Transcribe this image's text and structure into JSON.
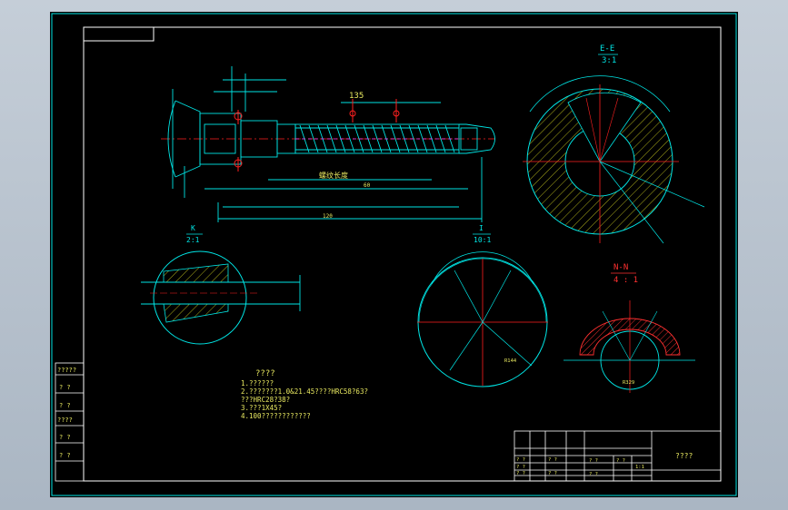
{
  "colors": {
    "background": "#000000",
    "frame": "#00e5e5",
    "outline": "#00e5e5",
    "section_line": "#ff2020",
    "hatch": "#d8d820",
    "thread": "#ff40ff",
    "text": "#e8e860"
  },
  "views": {
    "ee": {
      "label": "E-E",
      "scale": "3:1"
    },
    "k": {
      "label": "K",
      "scale": "2:1"
    },
    "i": {
      "label": "I",
      "scale": "10:1"
    },
    "nn": {
      "label": "N-N",
      "scale": "4 : 1"
    }
  },
  "dims": {
    "d135": "135",
    "d120": "120",
    "thread_callout": "螺纹长度",
    "d_total": "60",
    "d_bottom": "80",
    "r144": "R144",
    "r329": "R329"
  },
  "notes": {
    "title": "????",
    "lines": [
      "1.??????",
      "2.???????1.0&21.45????HRC58?63?",
      "???HRC28?38?",
      "3.???1X45?",
      "4.100????????????"
    ]
  },
  "side_table": [
    "?????",
    "? ?",
    "? ?",
    "????",
    "? ?",
    "? ?"
  ],
  "title_block": {
    "name": "????",
    "cells": [
      "? ?",
      "? ?",
      "? ?",
      "? ?",
      "? ?",
      "? ?",
      "? ?",
      "1:1",
      "? ?"
    ]
  }
}
